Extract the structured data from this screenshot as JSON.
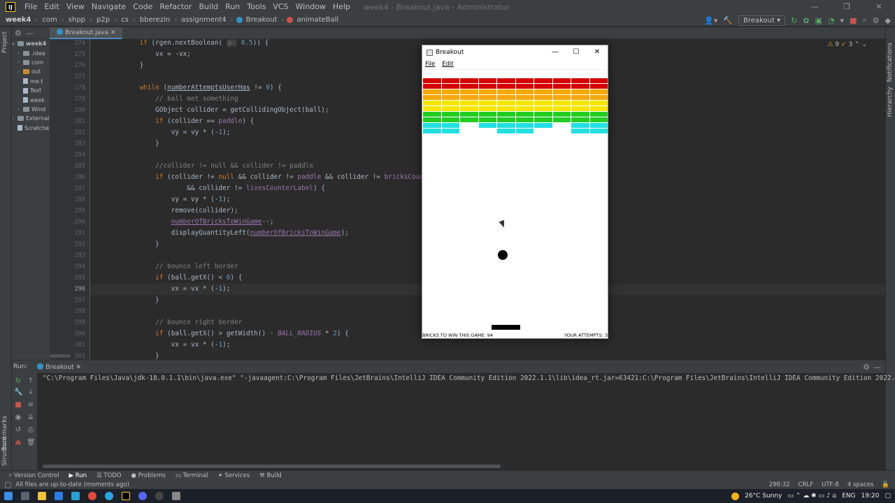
{
  "menubar": {
    "items": [
      "File",
      "Edit",
      "View",
      "Navigate",
      "Code",
      "Refactor",
      "Build",
      "Run",
      "Tools",
      "VCS",
      "Window",
      "Help"
    ],
    "window_title": "week4 - Breakout.java - Administrator"
  },
  "breadcrumb": [
    "week4",
    "com",
    "shpp",
    "p2p",
    "cs",
    "bberezin",
    "assignment4",
    "Breakout",
    "animateBall"
  ],
  "run_config": "Breakout",
  "project": {
    "tab_label": "Project",
    "root": "week4",
    "items": [
      ".idea",
      "com",
      "out",
      "me.t",
      "Text",
      "week",
      "Wind",
      "External",
      "Scratche"
    ]
  },
  "editor": {
    "tab_label": "Breakout.java",
    "inspection": "9",
    "inspection2": "3",
    "line_numbers": [
      "274",
      "275",
      "276",
      "277",
      "278",
      "279",
      "280",
      "281",
      "282",
      "283",
      "284",
      "285",
      "286",
      "287",
      "288",
      "289",
      "290",
      "291",
      "292",
      "293",
      "294",
      "295",
      "296",
      "297",
      "298",
      "299",
      "300",
      "301",
      "302"
    ],
    "current_line": "296"
  },
  "run": {
    "label": "Run:",
    "tab": "Breakout",
    "command": "\"C:\\Program Files\\Java\\jdk-18.0.1.1\\bin\\java.exe\" \"-javaagent:C:\\Program Files\\JetBrains\\IntelliJ IDEA Community Edition 2022.1.1\\lib\\idea_rt.jar=63421:C:\\Program Files\\JetBrains\\IntelliJ IDEA Community Edition 2022.1.1\\bin\" -"
  },
  "tool_tabs": [
    "Version Control",
    "Run",
    "TODO",
    "Problems",
    "Terminal",
    "Services",
    "Build"
  ],
  "status": {
    "message": "All files are up-to-date (moments ago)",
    "position": "296:32",
    "line_sep": "CRLF",
    "encoding": "UTF-8",
    "indent": "4 spaces"
  },
  "side_tabs": {
    "bookmarks": "Bookmarks",
    "structure": "Structure",
    "hierarchy": "Hierarchy",
    "notifications": "Notifications"
  },
  "taskbar": {
    "weather": "26°C  Sunny",
    "lang": "ENG",
    "time": "19:20"
  },
  "breakout": {
    "title": "Breakout",
    "menu": [
      "File",
      "Edit"
    ],
    "bricks_label": "BRICKS TO WIN THIS GAME: 94",
    "attempts_label": "YOUR ATTEMPTS: 3",
    "row_colors": [
      "#d40000",
      "#d40000",
      "#f5a800",
      "#f5a800",
      "#f5e600",
      "#f5e600",
      "#22cc22",
      "#22cc22",
      "#22e0e0",
      "#22e0e0"
    ],
    "bricks_grid": [
      [
        1,
        1,
        1,
        1,
        1,
        1,
        1,
        1,
        1,
        1
      ],
      [
        1,
        1,
        1,
        1,
        1,
        1,
        1,
        1,
        1,
        1
      ],
      [
        1,
        1,
        1,
        1,
        1,
        1,
        1,
        1,
        1,
        1
      ],
      [
        1,
        1,
        1,
        1,
        1,
        1,
        1,
        1,
        1,
        1
      ],
      [
        1,
        1,
        1,
        1,
        1,
        1,
        1,
        1,
        1,
        1
      ],
      [
        1,
        1,
        1,
        1,
        1,
        1,
        1,
        1,
        1,
        1
      ],
      [
        1,
        1,
        1,
        1,
        1,
        1,
        1,
        1,
        1,
        1
      ],
      [
        1,
        1,
        1,
        1,
        1,
        1,
        1,
        1,
        1,
        1
      ],
      [
        1,
        1,
        0,
        1,
        1,
        1,
        1,
        0,
        1,
        1
      ],
      [
        1,
        1,
        0,
        0,
        1,
        1,
        0,
        0,
        1,
        1
      ]
    ]
  }
}
